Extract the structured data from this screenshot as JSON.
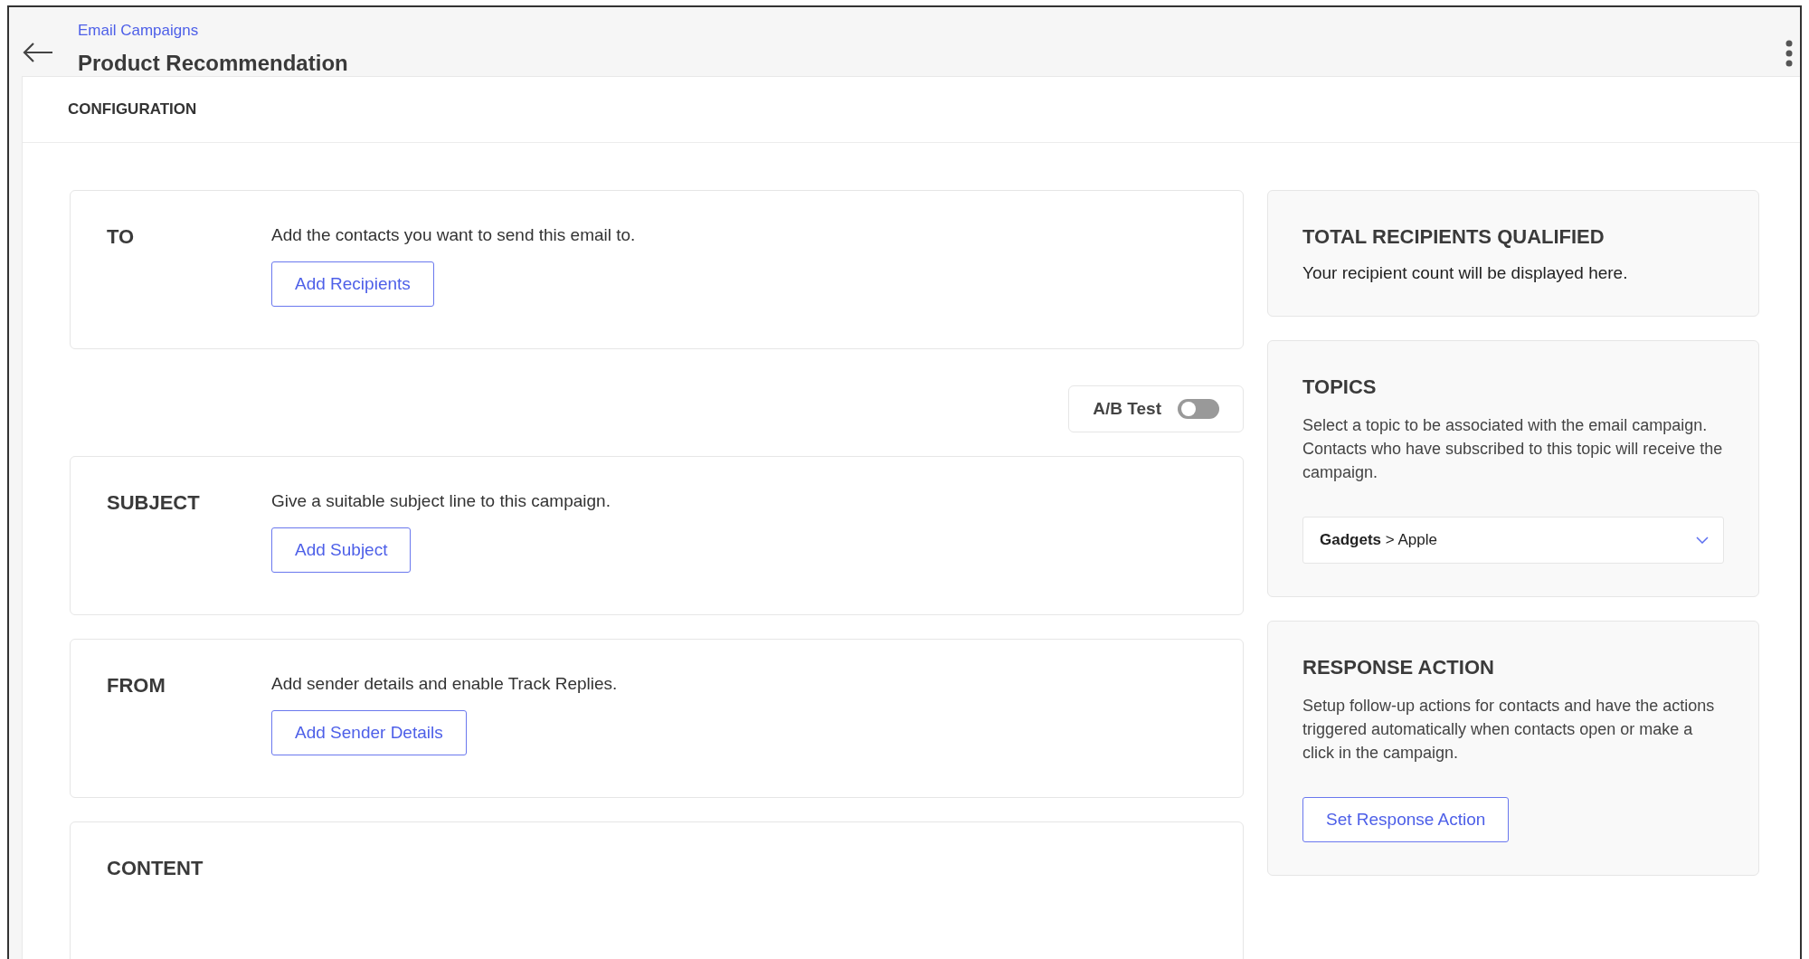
{
  "header": {
    "breadcrumb": "Email Campaigns",
    "title": "Product Recommendation"
  },
  "section_title": "CONFIGURATION",
  "steps": [
    {
      "kind": "step",
      "label": "TO",
      "description": "Add the contacts you want to send this email to.",
      "button": "Add Recipients"
    },
    {
      "kind": "toggle",
      "label": "A/B Test",
      "on": false
    },
    {
      "kind": "step",
      "label": "SUBJECT",
      "description": "Give a suitable subject line to this campaign.",
      "button": "Add Subject"
    },
    {
      "kind": "step",
      "label": "FROM",
      "description": "Add sender details and enable Track Replies.",
      "button": "Add Sender Details"
    },
    {
      "kind": "heading",
      "label": "CONTENT"
    }
  ],
  "side_cards": [
    {
      "kind": "info",
      "title": "TOTAL RECIPIENTS QUALIFIED",
      "text": "Your recipient count will be displayed here."
    },
    {
      "kind": "select",
      "title": "TOPICS",
      "text": "Select a topic to be associated with the email campaign. Contacts who have subscribed to this topic will receive the campaign.",
      "value": "**Gadgets** > Apple"
    },
    {
      "kind": "action",
      "title": "RESPONSE ACTION",
      "text": "Setup follow-up actions for contacts and have the actions triggered automatically when contacts open or make a click in the campaign.",
      "button": "Set Response Action"
    }
  ]
}
